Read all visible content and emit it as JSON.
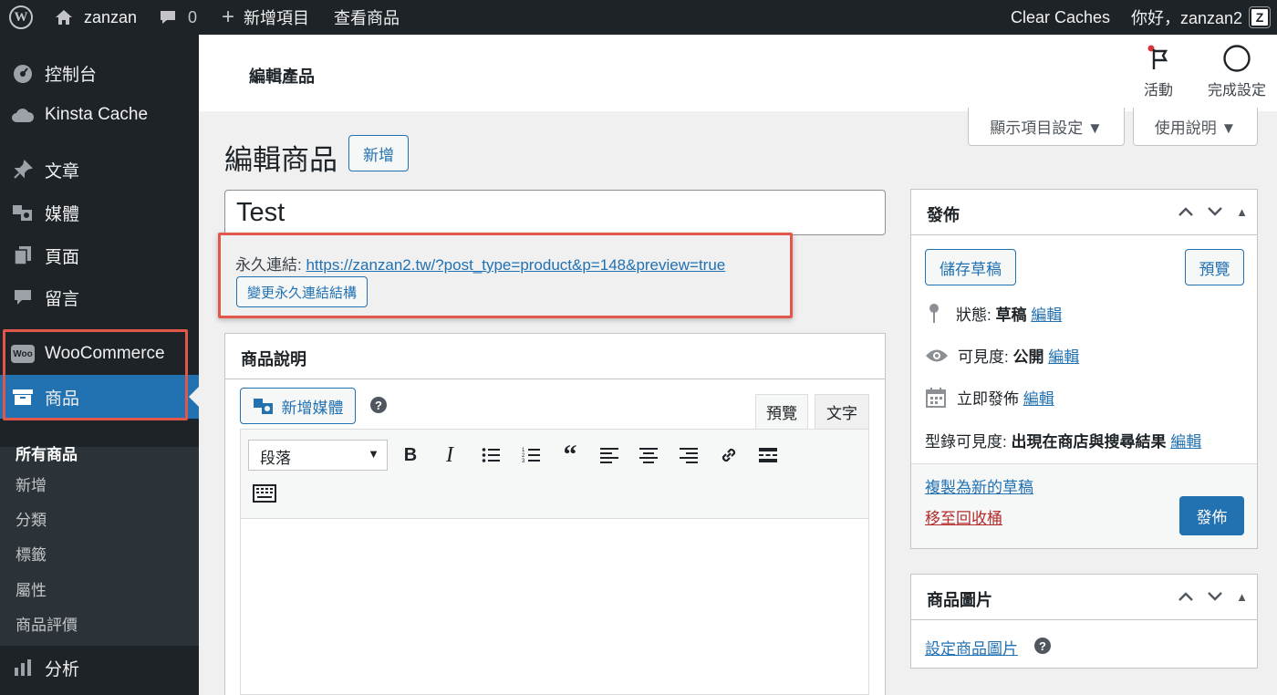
{
  "adminbar": {
    "site_name": "zanzan",
    "comments_count": "0",
    "new_label": "新增項目",
    "view_label": "查看商品",
    "clear_caches": "Clear Caches",
    "greeting": "你好，zanzan2"
  },
  "sidebar": {
    "items": [
      {
        "label": "控制台",
        "icon": "dashboard-icon"
      },
      {
        "label": "Kinsta Cache",
        "icon": "cloud-icon"
      },
      {
        "label": "文章",
        "icon": "pin-icon"
      },
      {
        "label": "媒體",
        "icon": "media-icon"
      },
      {
        "label": "頁面",
        "icon": "page-icon"
      },
      {
        "label": "留言",
        "icon": "comment-icon"
      },
      {
        "label": "WooCommerce",
        "icon": "woo-icon"
      },
      {
        "label": "商品",
        "icon": "archive-icon"
      },
      {
        "label": "分析",
        "icon": "chart-icon"
      }
    ],
    "submenu": [
      "所有商品",
      "新增",
      "分類",
      "標籤",
      "屬性",
      "商品評價"
    ]
  },
  "header": {
    "page_heading": "編輯產品",
    "activity_label": "活動",
    "setup_label": "完成設定",
    "screen_options": "顯示項目設定 ▼",
    "help": "使用說明 ▼"
  },
  "main": {
    "title": "編輯商品",
    "add_new": "新增",
    "post_title": "Test",
    "permalink_label": "永久連結:",
    "permalink_url": "https://zanzan2.tw/?post_type=product&p=148&preview=true",
    "change_permalink": "變更永久連結結構",
    "description_title": "商品說明",
    "add_media": "新增媒體",
    "tab_visual": "預覽",
    "tab_text": "文字",
    "format": "段落"
  },
  "publish": {
    "title": "發佈",
    "save_draft": "儲存草稿",
    "preview": "預覽",
    "status_label": "狀態:",
    "status_value": "草稿",
    "visibility_label": "可見度:",
    "visibility_value": "公開",
    "publish_immediately": "立即發佈",
    "catalog_label": "型錄可見度:",
    "catalog_value": "出現在商店與搜尋結果",
    "edit": "編輯",
    "copy_draft": "複製為新的草稿",
    "trash": "移至回收桶",
    "publish_button": "發佈"
  },
  "product_image": {
    "title": "商品圖片",
    "set_image": "設定商品圖片"
  },
  "colors": {
    "admin_dark": "#1d2327",
    "accent": "#2271b1",
    "highlight": "#e2574c"
  }
}
